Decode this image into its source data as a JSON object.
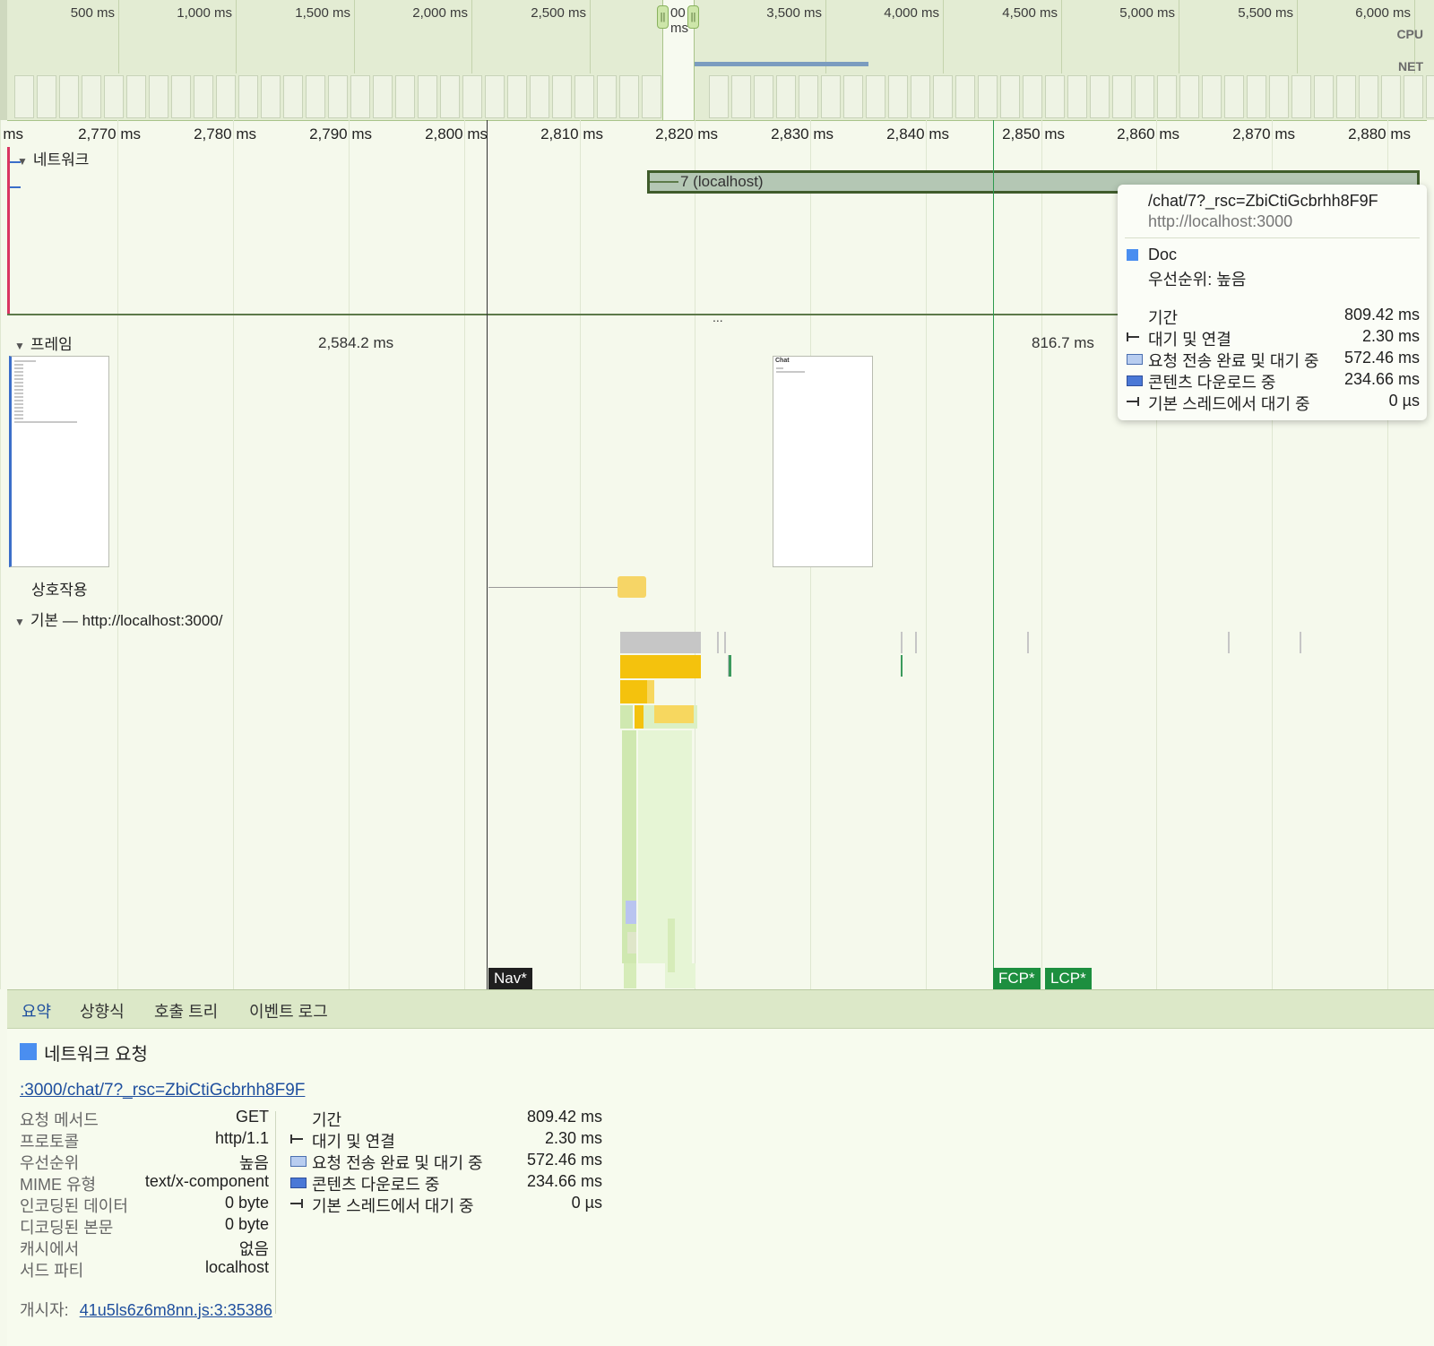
{
  "overview": {
    "ticks": [
      "500 ms",
      "1,000 ms",
      "1,500 ms",
      "2,000 ms",
      "2,500 ms",
      "3,000 ms",
      "3,500 ms",
      "4,000 ms",
      "4,500 ms",
      "5,000 ms",
      "5,500 ms",
      "6,000 ms"
    ],
    "selected_tick_label": "00 ms",
    "cpu_label": "CPU",
    "net_label": "NET"
  },
  "ruler": {
    "ticks": [
      "ms",
      "2,770 ms",
      "2,780 ms",
      "2,790 ms",
      "2,800 ms",
      "2,810 ms",
      "2,820 ms",
      "2,830 ms",
      "2,840 ms",
      "2,850 ms",
      "2,860 ms",
      "2,870 ms",
      "2,880 ms"
    ]
  },
  "tracks": {
    "network": {
      "title": "네트워크",
      "request_label": "7 (localhost)",
      "more": "..."
    },
    "frames": {
      "title": "프레임",
      "duration_a": "2,584.2 ms",
      "duration_b": "816.7 ms",
      "frame_b_text": "Chat"
    },
    "interactions": {
      "title": "상호작용"
    },
    "main": {
      "title": "기본 — http://localhost:3000/"
    }
  },
  "markers": {
    "nav": "Nav*",
    "fcp": "FCP*",
    "lcp": "LCP*"
  },
  "tooltip": {
    "url": "/chat/7?_rsc=ZbiCtiGcbrhh8F9F",
    "host": "http://localhost:3000",
    "resource_type": "Doc",
    "priority": "우선순위: 높음",
    "rows": [
      {
        "label": "기간",
        "value": "809.42 ms",
        "icon": "none"
      },
      {
        "label": "대기 및 연결",
        "value": "2.30 ms",
        "icon": "whisker-left"
      },
      {
        "label": "요청 전송 완료 및 대기 중",
        "value": "572.46 ms",
        "icon": "box-light"
      },
      {
        "label": "콘텐츠 다운로드 중",
        "value": "234.66 ms",
        "icon": "box-dark"
      },
      {
        "label": "기본 스레드에서 대기 중",
        "value": "0 µs",
        "icon": "whisker-right"
      }
    ]
  },
  "bottom": {
    "tabs": [
      "요약",
      "상향식",
      "호출 트리",
      "이벤트 로그"
    ],
    "active_tab": "요약",
    "title": "네트워크 요청",
    "link": ":3000/chat/7?_rsc=ZbiCtiGcbrhh8F9F",
    "properties": [
      {
        "key": "요청 메서드",
        "value": "GET"
      },
      {
        "key": "프로토콜",
        "value": "http/1.1"
      },
      {
        "key": "우선순위",
        "value": "높음"
      },
      {
        "key": "MIME 유형",
        "value": "text/x-component"
      },
      {
        "key": "인코딩된 데이터",
        "value": "0 byte"
      },
      {
        "key": "디코딩된 본문",
        "value": "0 byte"
      },
      {
        "key": "캐시에서",
        "value": "없음"
      },
      {
        "key": "서드 파티",
        "value": "localhost"
      }
    ],
    "timing": [
      {
        "label": "기간",
        "value": "809.42 ms",
        "icon": "none"
      },
      {
        "label": "대기 및 연결",
        "value": "2.30 ms",
        "icon": "whisker-left"
      },
      {
        "label": "요청 전송 완료 및 대기 중",
        "value": "572.46 ms",
        "icon": "box-light"
      },
      {
        "label": "콘텐츠 다운로드 중",
        "value": "234.66 ms",
        "icon": "box-dark"
      },
      {
        "label": "기본 스레드에서 대기 중",
        "value": "0 µs",
        "icon": "whisker-right"
      }
    ],
    "initiator_label": "개시자:",
    "initiator_link": "41u5ls6z6m8nn.js:3:35386"
  },
  "colors": {
    "doc": "#4a8ef0",
    "nav_line": "#333333",
    "fcp_line": "#2e9a4f",
    "track_accent": "#d93562"
  }
}
